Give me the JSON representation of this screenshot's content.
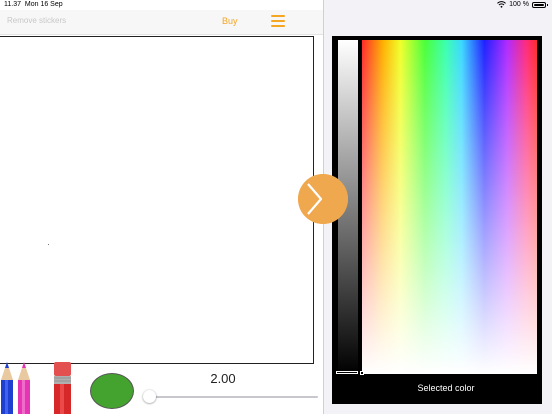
{
  "status_bar": {
    "time": "11.37",
    "date": "Mon 16 Sep",
    "battery": "100 %"
  },
  "nav": {
    "remove_stickers": "Remove stickers",
    "buy": "Buy"
  },
  "toolbar": {
    "brush_size": "2.00",
    "brush_size_slider": 0.0,
    "selected_color": "#44a32f",
    "pencil_colors": [
      "#1e3fd0",
      "#e534b4"
    ]
  },
  "picker": {
    "selected_color_label": "Selected color"
  },
  "colors": {
    "accent": "#f5a623",
    "toggle_tab": "#f0a84e"
  }
}
